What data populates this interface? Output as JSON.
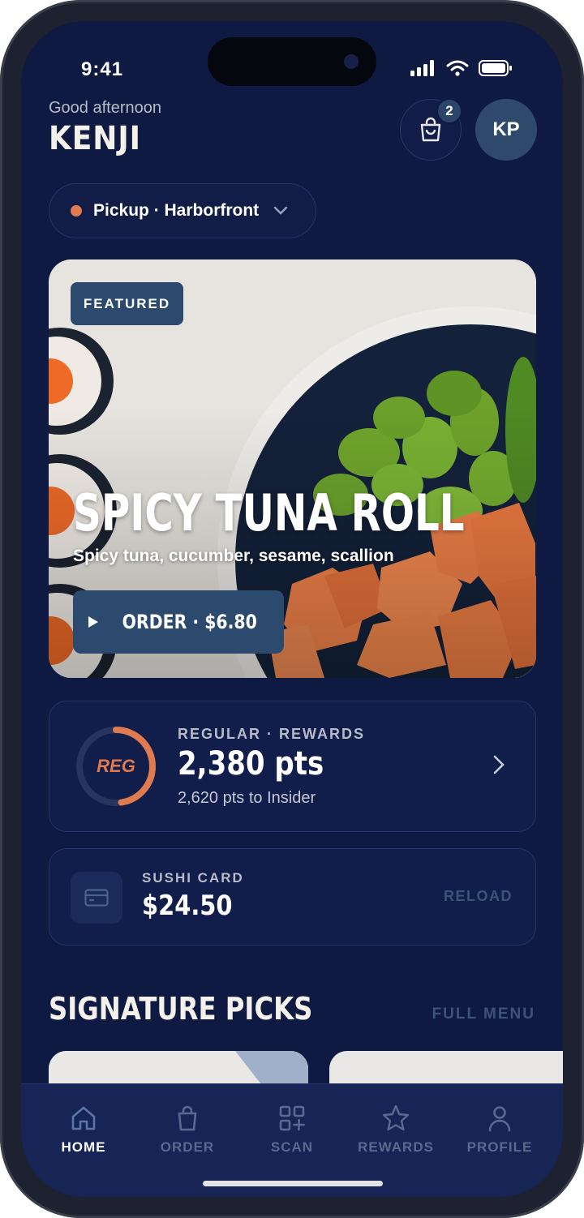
{
  "status_bar": {
    "time": "9:41"
  },
  "header": {
    "greeting": "Good afternoon",
    "username": "KENJI",
    "cart_count": "2",
    "avatar_initials": "KP"
  },
  "location": {
    "label": "Pickup · Harborfront"
  },
  "hero": {
    "tag": "FEATURED",
    "title": "SPICY TUNA ROLL",
    "subtitle": "Spicy tuna, cucumber, sesame, scallion",
    "order_button": "ORDER · $6.80"
  },
  "rewards": {
    "badge": "REG",
    "tier_label": "REGULAR · REWARDS",
    "points": "2,380 pts",
    "next_tier": "2,620 pts to Insider",
    "progress_fraction": 0.476
  },
  "sushi_card": {
    "label": "SUSHI CARD",
    "balance": "$24.50",
    "reload": "RELOAD"
  },
  "signature": {
    "title": "SIGNATURE PICKS",
    "full_menu": "FULL MENU"
  },
  "tabs": [
    {
      "label": "HOME",
      "icon": "home-icon",
      "active": true
    },
    {
      "label": "ORDER",
      "icon": "bag-icon",
      "active": false
    },
    {
      "label": "SCAN",
      "icon": "scan-icon",
      "active": false
    },
    {
      "label": "REWARDS",
      "icon": "star-icon",
      "active": false
    },
    {
      "label": "PROFILE",
      "icon": "person-icon",
      "active": false
    }
  ],
  "colors": {
    "background": "#0f1a42",
    "accent": "#e07b4f",
    "button": "#2c4a6e",
    "muted_link": "#3b5478"
  }
}
